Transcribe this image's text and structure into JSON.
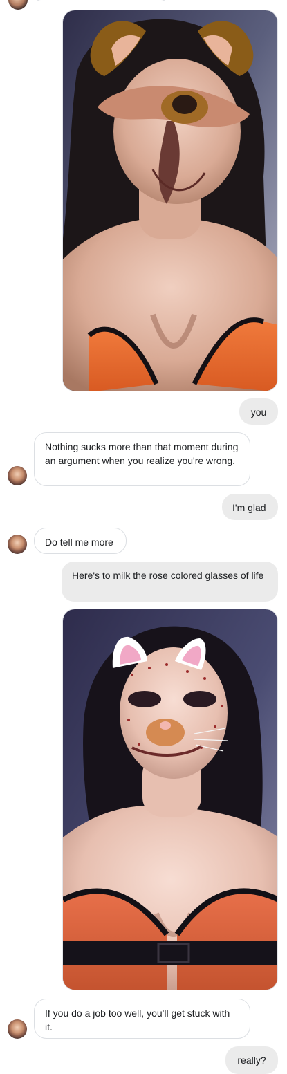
{
  "thread": {
    "messages": [
      {
        "id": "m1",
        "sender": "me",
        "kind": "photo",
        "filter": "dog-ears-icon"
      },
      {
        "id": "m2",
        "sender": "me",
        "kind": "text",
        "text": "you"
      },
      {
        "id": "m3",
        "sender": "them",
        "kind": "text",
        "text": "Nothing sucks more than that moment during an argument when you realize you're wrong."
      },
      {
        "id": "m4",
        "sender": "me",
        "kind": "text",
        "text": "I'm glad"
      },
      {
        "id": "m5",
        "sender": "them",
        "kind": "text",
        "text": "Do tell me more"
      },
      {
        "id": "m6",
        "sender": "me",
        "kind": "text",
        "text": "Here's to milk the rose colored glasses of life"
      },
      {
        "id": "m7",
        "sender": "me",
        "kind": "photo",
        "filter": "cat-ears-icon"
      },
      {
        "id": "m8",
        "sender": "them",
        "kind": "text",
        "text": "If you do a job too well, you'll get stuck with it."
      },
      {
        "id": "m9",
        "sender": "me",
        "kind": "text",
        "text": "really?"
      }
    ]
  },
  "colors": {
    "outgoing_bubble": "#ebebeb",
    "incoming_bubble": "#ffffff",
    "incoming_border": "#dcdfe3",
    "text": "#1c1e21"
  }
}
